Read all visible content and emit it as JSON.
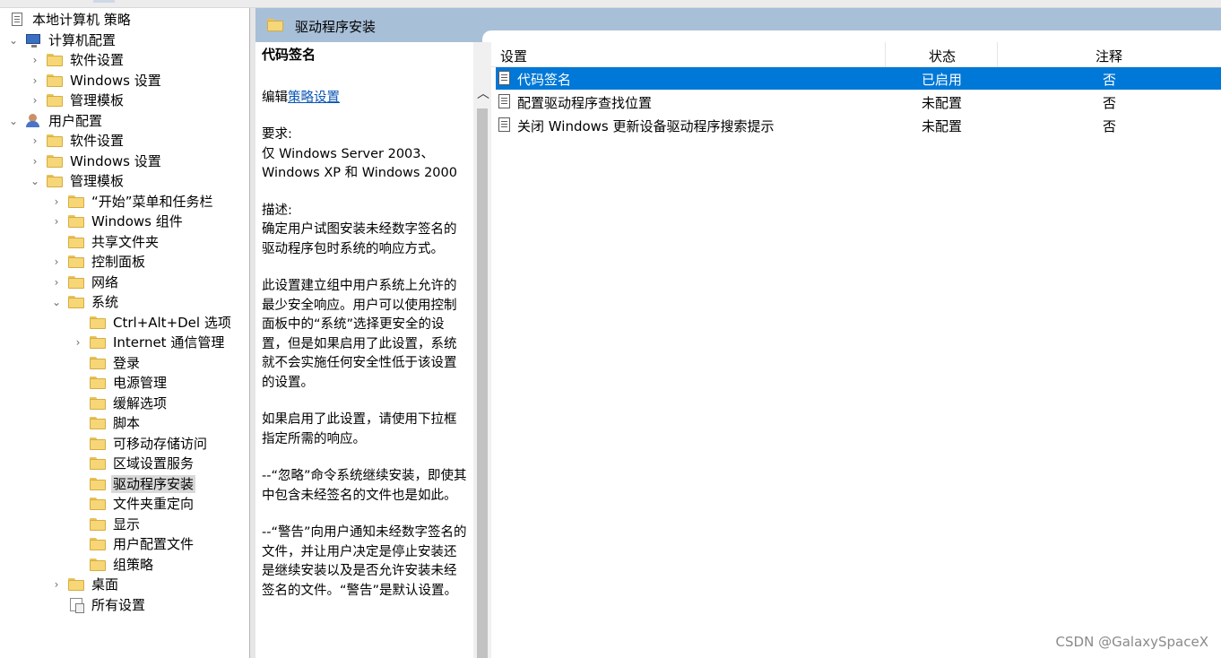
{
  "tree": {
    "items": [
      {
        "label": "本地计算机 策略",
        "expander": "",
        "icon": "policy-icon"
      },
      {
        "label": "计算机配置",
        "expander": "⌄",
        "icon": "computer-icon"
      },
      {
        "label": "软件设置",
        "expander": "›",
        "icon": "folder-icon"
      },
      {
        "label": "Windows 设置",
        "expander": "›",
        "icon": "folder-icon"
      },
      {
        "label": "管理模板",
        "expander": "›",
        "icon": "folder-icon"
      },
      {
        "label": "用户配置",
        "expander": "⌄",
        "icon": "user-icon"
      },
      {
        "label": "软件设置",
        "expander": "›",
        "icon": "folder-icon"
      },
      {
        "label": "Windows 设置",
        "expander": "›",
        "icon": "folder-icon"
      },
      {
        "label": "管理模板",
        "expander": "⌄",
        "icon": "folder-icon"
      },
      {
        "label": "“开始”菜单和任务栏",
        "expander": "›",
        "icon": "folder-icon"
      },
      {
        "label": "Windows 组件",
        "expander": "›",
        "icon": "folder-icon"
      },
      {
        "label": "共享文件夹",
        "expander": "",
        "icon": "folder-icon"
      },
      {
        "label": "控制面板",
        "expander": "›",
        "icon": "folder-icon"
      },
      {
        "label": "网络",
        "expander": "›",
        "icon": "folder-icon"
      },
      {
        "label": "系统",
        "expander": "⌄",
        "icon": "folder-icon"
      },
      {
        "label": "Ctrl+Alt+Del 选项",
        "expander": "",
        "icon": "folder-icon"
      },
      {
        "label": "Internet 通信管理",
        "expander": "›",
        "icon": "folder-icon"
      },
      {
        "label": "登录",
        "expander": "",
        "icon": "folder-icon"
      },
      {
        "label": "电源管理",
        "expander": "",
        "icon": "folder-icon"
      },
      {
        "label": "缓解选项",
        "expander": "",
        "icon": "folder-icon"
      },
      {
        "label": "脚本",
        "expander": "",
        "icon": "folder-icon"
      },
      {
        "label": "可移动存储访问",
        "expander": "",
        "icon": "folder-icon"
      },
      {
        "label": "区域设置服务",
        "expander": "",
        "icon": "folder-icon"
      },
      {
        "label": "驱动程序安装",
        "expander": "",
        "icon": "folder-icon",
        "selected": true
      },
      {
        "label": "文件夹重定向",
        "expander": "",
        "icon": "folder-icon"
      },
      {
        "label": "显示",
        "expander": "",
        "icon": "folder-icon"
      },
      {
        "label": "用户配置文件",
        "expander": "",
        "icon": "folder-icon"
      },
      {
        "label": "组策略",
        "expander": "",
        "icon": "folder-icon"
      },
      {
        "label": "桌面",
        "expander": "›",
        "icon": "folder-icon"
      },
      {
        "label": "所有设置",
        "expander": "",
        "icon": "all-settings-icon"
      }
    ]
  },
  "header": {
    "title": "驱动程序安装"
  },
  "desc": {
    "title": "代码签名",
    "edit_prefix": "编辑",
    "edit_link": "策略设置",
    "req_label": "要求:",
    "req_text": "仅 Windows Server 2003、Windows XP 和 Windows 2000",
    "desc_label": "描述:",
    "desc_text": "确定用户试图安装未经数字签名的驱动程序包时系统的响应方式。",
    "para1": "此设置建立组中用户系统上允许的最少安全响应。用户可以使用控制面板中的“系统”选择更安全的设置，但是如果启用了此设置，系统就不会实施任何安全性低于该设置的设置。",
    "para2": "如果启用了此设置，请使用下拉框指定所需的响应。",
    "para3": "--“忽略”命令系统继续安装，即使其中包含未经签名的文件也是如此。",
    "para4": "--“警告”向用户通知未经数字签名的文件，并让用户决定是停止安装还是继续安装以及是否允许安装未经签名的文件。“警告”是默认设置。"
  },
  "list": {
    "columns": {
      "setting": "设置",
      "state": "状态",
      "note": "注释"
    },
    "rows": [
      {
        "name": "代码签名",
        "state": "已启用",
        "note": "否",
        "selected": true
      },
      {
        "name": "配置驱动程序查找位置",
        "state": "未配置",
        "note": "否"
      },
      {
        "name": "关闭 Windows 更新设备驱动程序搜索提示",
        "state": "未配置",
        "note": "否"
      }
    ]
  },
  "colors": {
    "selection": "#0078d7",
    "header_bar": "#a8bfd8",
    "link": "#0a55b3",
    "tree_selected": "#d9d9d9"
  },
  "watermark": "CSDN @GalaxySpaceX"
}
